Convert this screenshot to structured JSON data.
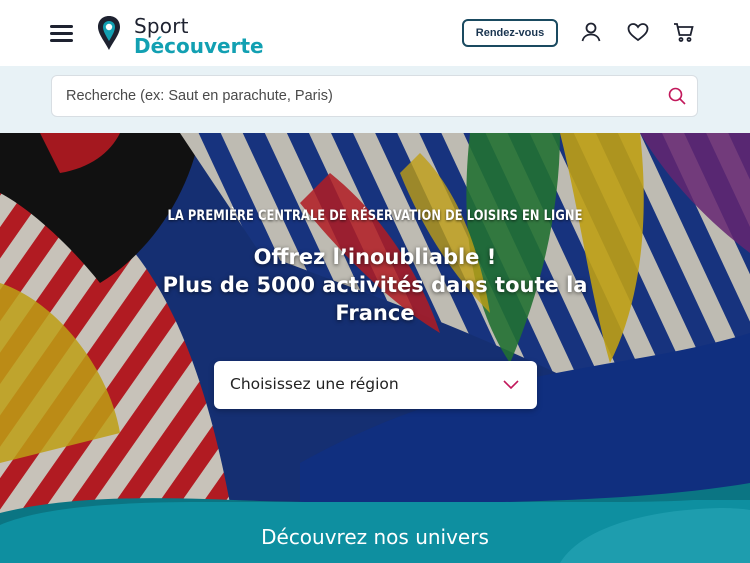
{
  "header": {
    "logo": {
      "line1": "Sport",
      "line2": "Découverte"
    },
    "appointment_label": "Rendez-vous",
    "icons": [
      "menu-icon",
      "user-icon",
      "heart-icon",
      "cart-icon"
    ]
  },
  "search": {
    "placeholder": "Recherche (ex: Saut en parachute, Paris)",
    "value": ""
  },
  "hero": {
    "kicker": "LA PREMIÈRE CENTRALE DE RÉSERVATION DE LOISIRS EN LIGNE",
    "title_line1": "Offrez l’inoubliable !",
    "title_line2": "Plus de 5000 activités dans toute la France",
    "region_select": {
      "selected": "Choisissez une région"
    }
  },
  "univers": {
    "title": "Découvrez nos univers"
  },
  "colors": {
    "brand_teal": "#12a0b2",
    "brand_dark": "#1e2230",
    "search_band": "#e8f2f6",
    "accent_pink": "#c2185b",
    "univers_teal": "#0e8fa0"
  }
}
